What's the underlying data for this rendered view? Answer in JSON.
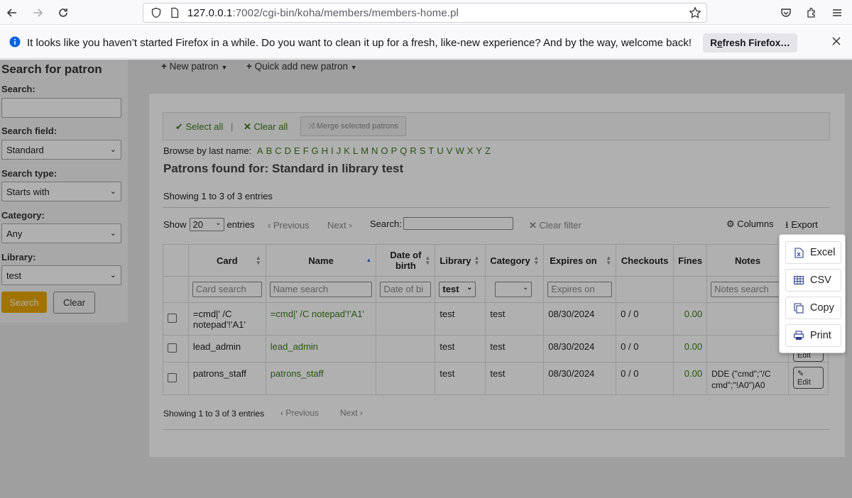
{
  "browser": {
    "url_host": "127.0.0.1",
    "url_rest": ":7002/cgi-bin/koha/members/members-home.pl",
    "notification": "It looks like you haven’t started Firefox in a while. Do you want to clean it up for a fresh, like-new experience? And by the way, welcome back!",
    "refresh_label_pre": "R",
    "refresh_label_key": "e",
    "refresh_label_post": "fresh Firefox…"
  },
  "sidebar": {
    "title": "Search for patron",
    "search_label": "Search:",
    "search_value": "",
    "field_label": "Search field:",
    "field_value": "Standard",
    "type_label": "Search type:",
    "type_value": "Starts with",
    "category_label": "Category:",
    "category_value": "Any",
    "library_label": "Library:",
    "library_value": "test",
    "search_button": "Search",
    "clear_button": "Clear"
  },
  "toolbar": {
    "new_patron": "New patron",
    "quick_add": "Quick add new patron"
  },
  "selection": {
    "select_all": "Select all",
    "separator": "|",
    "clear_all": "Clear all",
    "merge": "Merge selected patrons"
  },
  "browse": {
    "label": "Browse by last name:",
    "letters": [
      "A",
      "B",
      "C",
      "D",
      "E",
      "F",
      "G",
      "H",
      "I",
      "J",
      "K",
      "L",
      "M",
      "N",
      "O",
      "P",
      "Q",
      "R",
      "S",
      "T",
      "U",
      "V",
      "W",
      "X",
      "Y",
      "Z"
    ]
  },
  "results": {
    "heading": "Patrons found for: Standard in library test",
    "showing_top": "Showing 1 to 3 of 3 entries",
    "showing_bottom": "Showing 1 to 3 of 3 entries",
    "show_label": "Show",
    "page_size": "20",
    "entries_label": "entries",
    "previous": "Previous",
    "next": "Next",
    "search_label": "Search:",
    "clear_filter": "Clear filter",
    "columns": "Columns",
    "export": "Export"
  },
  "table": {
    "headers": {
      "card": "Card",
      "name": "Name",
      "dob_line1": "Date of",
      "dob_line2": "birth",
      "library": "Library",
      "category": "Category",
      "expires": "Expires on",
      "checkouts": "Checkouts",
      "fines": "Fines",
      "notes": "Notes"
    },
    "filters": {
      "card": "Card search",
      "name": "Name search",
      "dob": "Date of bi",
      "library": "test",
      "category": "",
      "expires": "Expires on",
      "notes": "Notes search"
    },
    "rows": [
      {
        "card_line1": "=cmd|' /C",
        "card_line2": "notepad'!'A1'",
        "name": "=cmd|' /C notepad'!'A1'",
        "library": "test",
        "category": "test",
        "expires": "08/30/2024",
        "checkouts": "0 / 0",
        "fines": "0.00",
        "notes_line1": "",
        "notes_line2": ""
      },
      {
        "card_line1": "lead_admin",
        "card_line2": "",
        "name": "lead_admin",
        "library": "test",
        "category": "test",
        "expires": "08/30/2024",
        "checkouts": "0 / 0",
        "fines": "0.00",
        "notes_line1": "",
        "notes_line2": ""
      },
      {
        "card_line1": "patrons_staff",
        "card_line2": "",
        "name": "patrons_staff",
        "library": "test",
        "category": "test",
        "expires": "08/30/2024",
        "checkouts": "0 / 0",
        "fines": "0.00",
        "notes_line1": "DDE (\"cmd\";\"/C",
        "notes_line2": "cmd\";\"!A0\")A0"
      }
    ],
    "edit_label": "Edit"
  },
  "export_menu": {
    "excel": "Excel",
    "csv": "CSV",
    "copy": "Copy",
    "print": "Print"
  }
}
